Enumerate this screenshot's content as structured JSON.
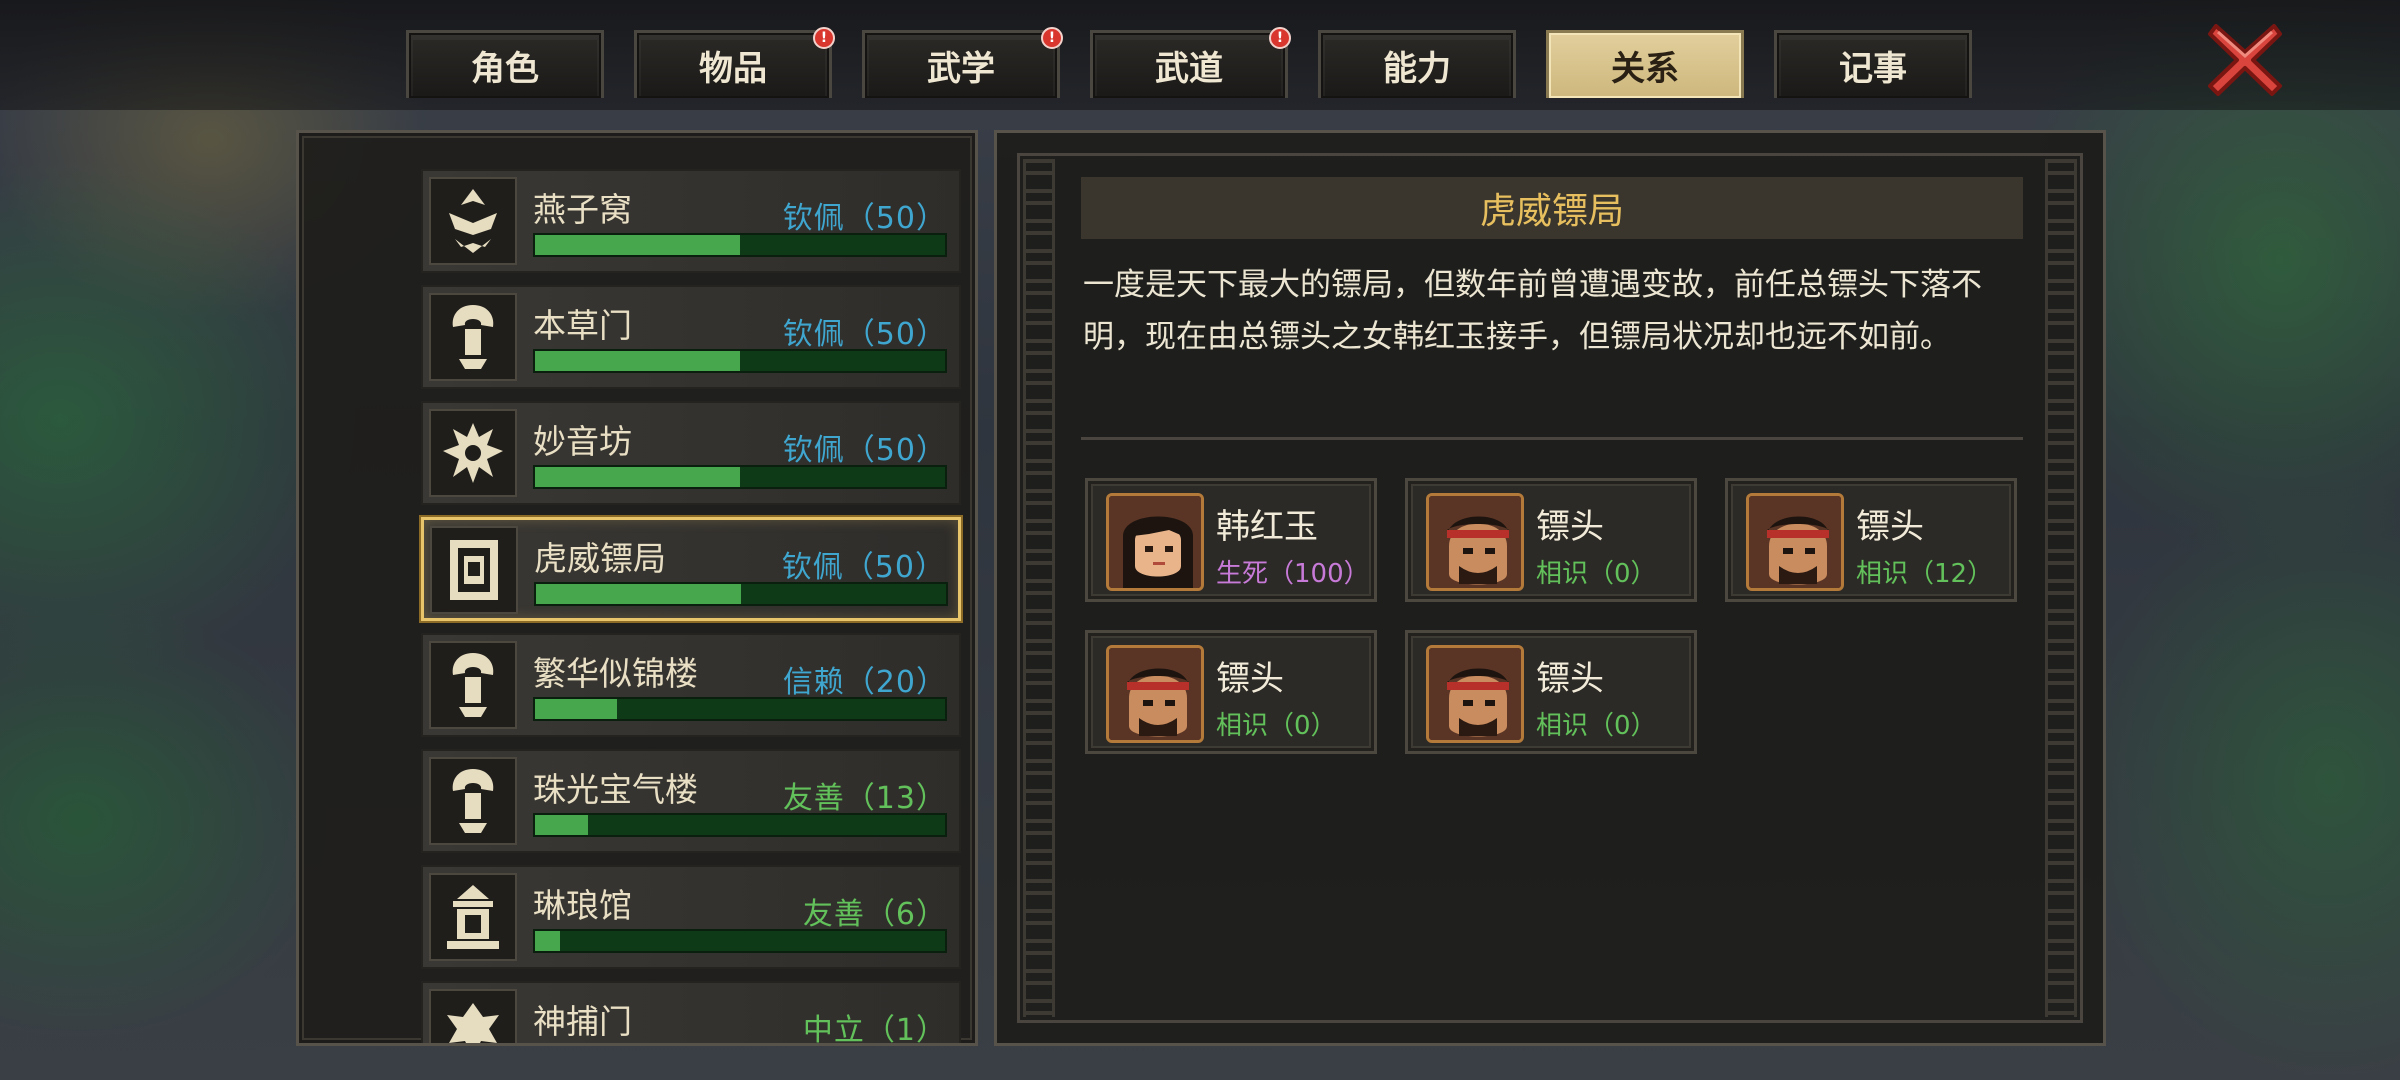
{
  "tabs": [
    {
      "label": "角色",
      "badge": ""
    },
    {
      "label": "物品",
      "badge": "!"
    },
    {
      "label": "武学",
      "badge": "!"
    },
    {
      "label": "武道",
      "badge": "!"
    },
    {
      "label": "能力",
      "badge": ""
    },
    {
      "label": "关系",
      "badge": ""
    },
    {
      "label": "记事",
      "badge": ""
    }
  ],
  "active_tab": "关系",
  "close_icon": "close-x-icon",
  "factions": [
    {
      "name": "燕子窝",
      "status": "钦佩（50）",
      "status_color": "#3fa6cf",
      "progress": 0.5,
      "emblem": "swallow-crest-icon"
    },
    {
      "name": "本草门",
      "status": "钦佩（50）",
      "status_color": "#3fa6cf",
      "progress": 0.5,
      "emblem": "herb-crest-icon"
    },
    {
      "name": "妙音坊",
      "status": "钦佩（50）",
      "status_color": "#3fa6cf",
      "progress": 0.5,
      "emblem": "music-crest-icon"
    },
    {
      "name": "虎威镖局",
      "status": "钦佩（50）",
      "status_color": "#3fa6cf",
      "progress": 0.5,
      "emblem": "escort-crest-icon"
    },
    {
      "name": "繁华似锦楼",
      "status": "信赖（20）",
      "status_color": "#3fa6cf",
      "progress": 0.2,
      "emblem": "tower-crest-icon"
    },
    {
      "name": "珠光宝气楼",
      "status": "友善（13）",
      "status_color": "#62c15a",
      "progress": 0.13,
      "emblem": "treasure-crest-icon"
    },
    {
      "name": "琳琅馆",
      "status": "友善（6）",
      "status_color": "#62c15a",
      "progress": 0.06,
      "emblem": "pavilion-crest-icon"
    },
    {
      "name": "神捕门",
      "status": "中立（1）",
      "status_color": "#62c15a",
      "progress": 0.01,
      "emblem": "constable-crest-icon"
    }
  ],
  "selected_faction": "虎威镖局",
  "detail": {
    "title": "虎威镖局",
    "description": "一度是天下最大的镖局，但数年前曾遭遇变故，前任总镖头下落不明，现在由总镖头之女韩红玉接手，但镖局状况却也远不如前。"
  },
  "members": [
    {
      "name": "韩红玉",
      "relation": "生死（100）",
      "relation_color": "#c77ad8",
      "portrait": "female-portrait-icon"
    },
    {
      "name": "镖头",
      "relation": "相识（0）",
      "relation_color": "#62c15a",
      "portrait": "male-headband-portrait-icon"
    },
    {
      "name": "镖头",
      "relation": "相识（12）",
      "relation_color": "#62c15a",
      "portrait": "male-headband-portrait-icon"
    },
    {
      "name": "镖头",
      "relation": "相识（0）",
      "relation_color": "#62c15a",
      "portrait": "male-headband-portrait-icon"
    },
    {
      "name": "镖头",
      "relation": "相识（0）",
      "relation_color": "#62c15a",
      "portrait": "male-headband-portrait-icon"
    }
  ]
}
